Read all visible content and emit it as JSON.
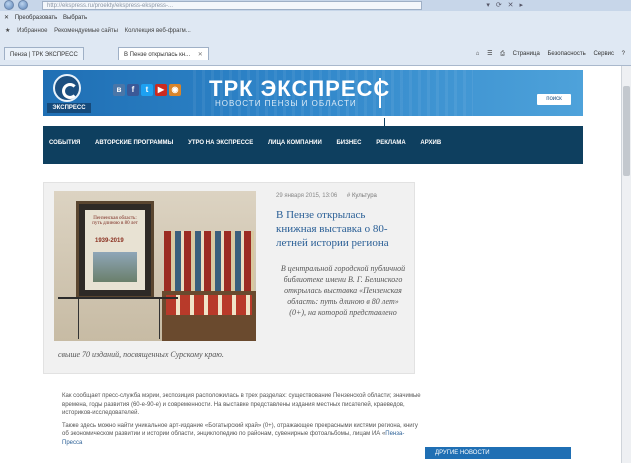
{
  "browser": {
    "url": "http://ekspress.ru/proekty/ekspress-ekspress-...",
    "menu": [
      "Преобразовать",
      "Выбрать"
    ],
    "favorites": [
      "Избранное",
      "Рекомендуемые сайты",
      "Коллекция веб-фрагм..."
    ],
    "tabs": [
      {
        "label": "Пенза | ТРК ЭКСПРЕСС",
        "active": false
      },
      {
        "label": "В Пензе открылась кн...",
        "active": true
      }
    ],
    "commands": [
      "Страница",
      "Безопасность",
      "Сервис"
    ]
  },
  "site": {
    "logo_text": "ЭКСПРЕСС",
    "brand_title": "ТРК ЭКСПРЕСС",
    "brand_subtitle": "НОВОСТИ ПЕНЗЫ И ОБЛАСТИ",
    "search_label": "поиск",
    "social": [
      {
        "icon": "vk-icon",
        "glyph": "в",
        "color": "#4a76a8"
      },
      {
        "icon": "facebook-icon",
        "glyph": "f",
        "color": "#3b5998"
      },
      {
        "icon": "twitter-icon",
        "glyph": "t",
        "color": "#1da1f2"
      },
      {
        "icon": "youtube-icon",
        "glyph": "▶",
        "color": "#cc2a1f"
      },
      {
        "icon": "instagram-icon",
        "glyph": "◉",
        "color": "#d9852a"
      }
    ]
  },
  "nav": {
    "items": [
      "СОБЫТИЯ",
      "АВТОРСКИЕ ПРОГРАММЫ",
      "УТРО НА ЭКСПРЕССЕ",
      "ЛИЦА КОМПАНИИ",
      "БИЗНЕС",
      "РЕКЛАМА",
      "АРХИВ"
    ]
  },
  "featured": {
    "meta_date": "29 января 2015, 13:06",
    "meta_category": "Культура",
    "title": "В Пензе открылась книжная выставка о 80-летней истории региона",
    "lead": "В центральной городской публичной библиотеке имени В. Г. Белинского открылась выставка «Пензенская область: путь длиною в 80 лет» (0+), на которой представлено",
    "lead_tail": "свыше 70 изданий, посвященных Сурскому краю.",
    "poster_text": "Пензенская область: путь длиною в 80 лет",
    "poster_years": "1939-2019"
  },
  "article": {
    "p1": "Как сообщает пресс-служба мэрии, экспозиция расположилась в трех разделах: существование Пензенской области; значимые времена, годы развития (60-е-90-е) и современности. На выставке представлены издания местных писателей, краеведов, историков-исследователей.",
    "p2_start": "Также здесь можно найти уникальное арт-издание «Богатырский край» (0+), отражающее прекрасными кистями региона, книгу об экономическом развитии и истории области, энциклопедию по районам, сувенирные фотоальбомы, лицам ИА «",
    "p2_link": "Пенза-Пресса",
    "other_news": "ДРУГИЕ НОВОСТИ"
  }
}
